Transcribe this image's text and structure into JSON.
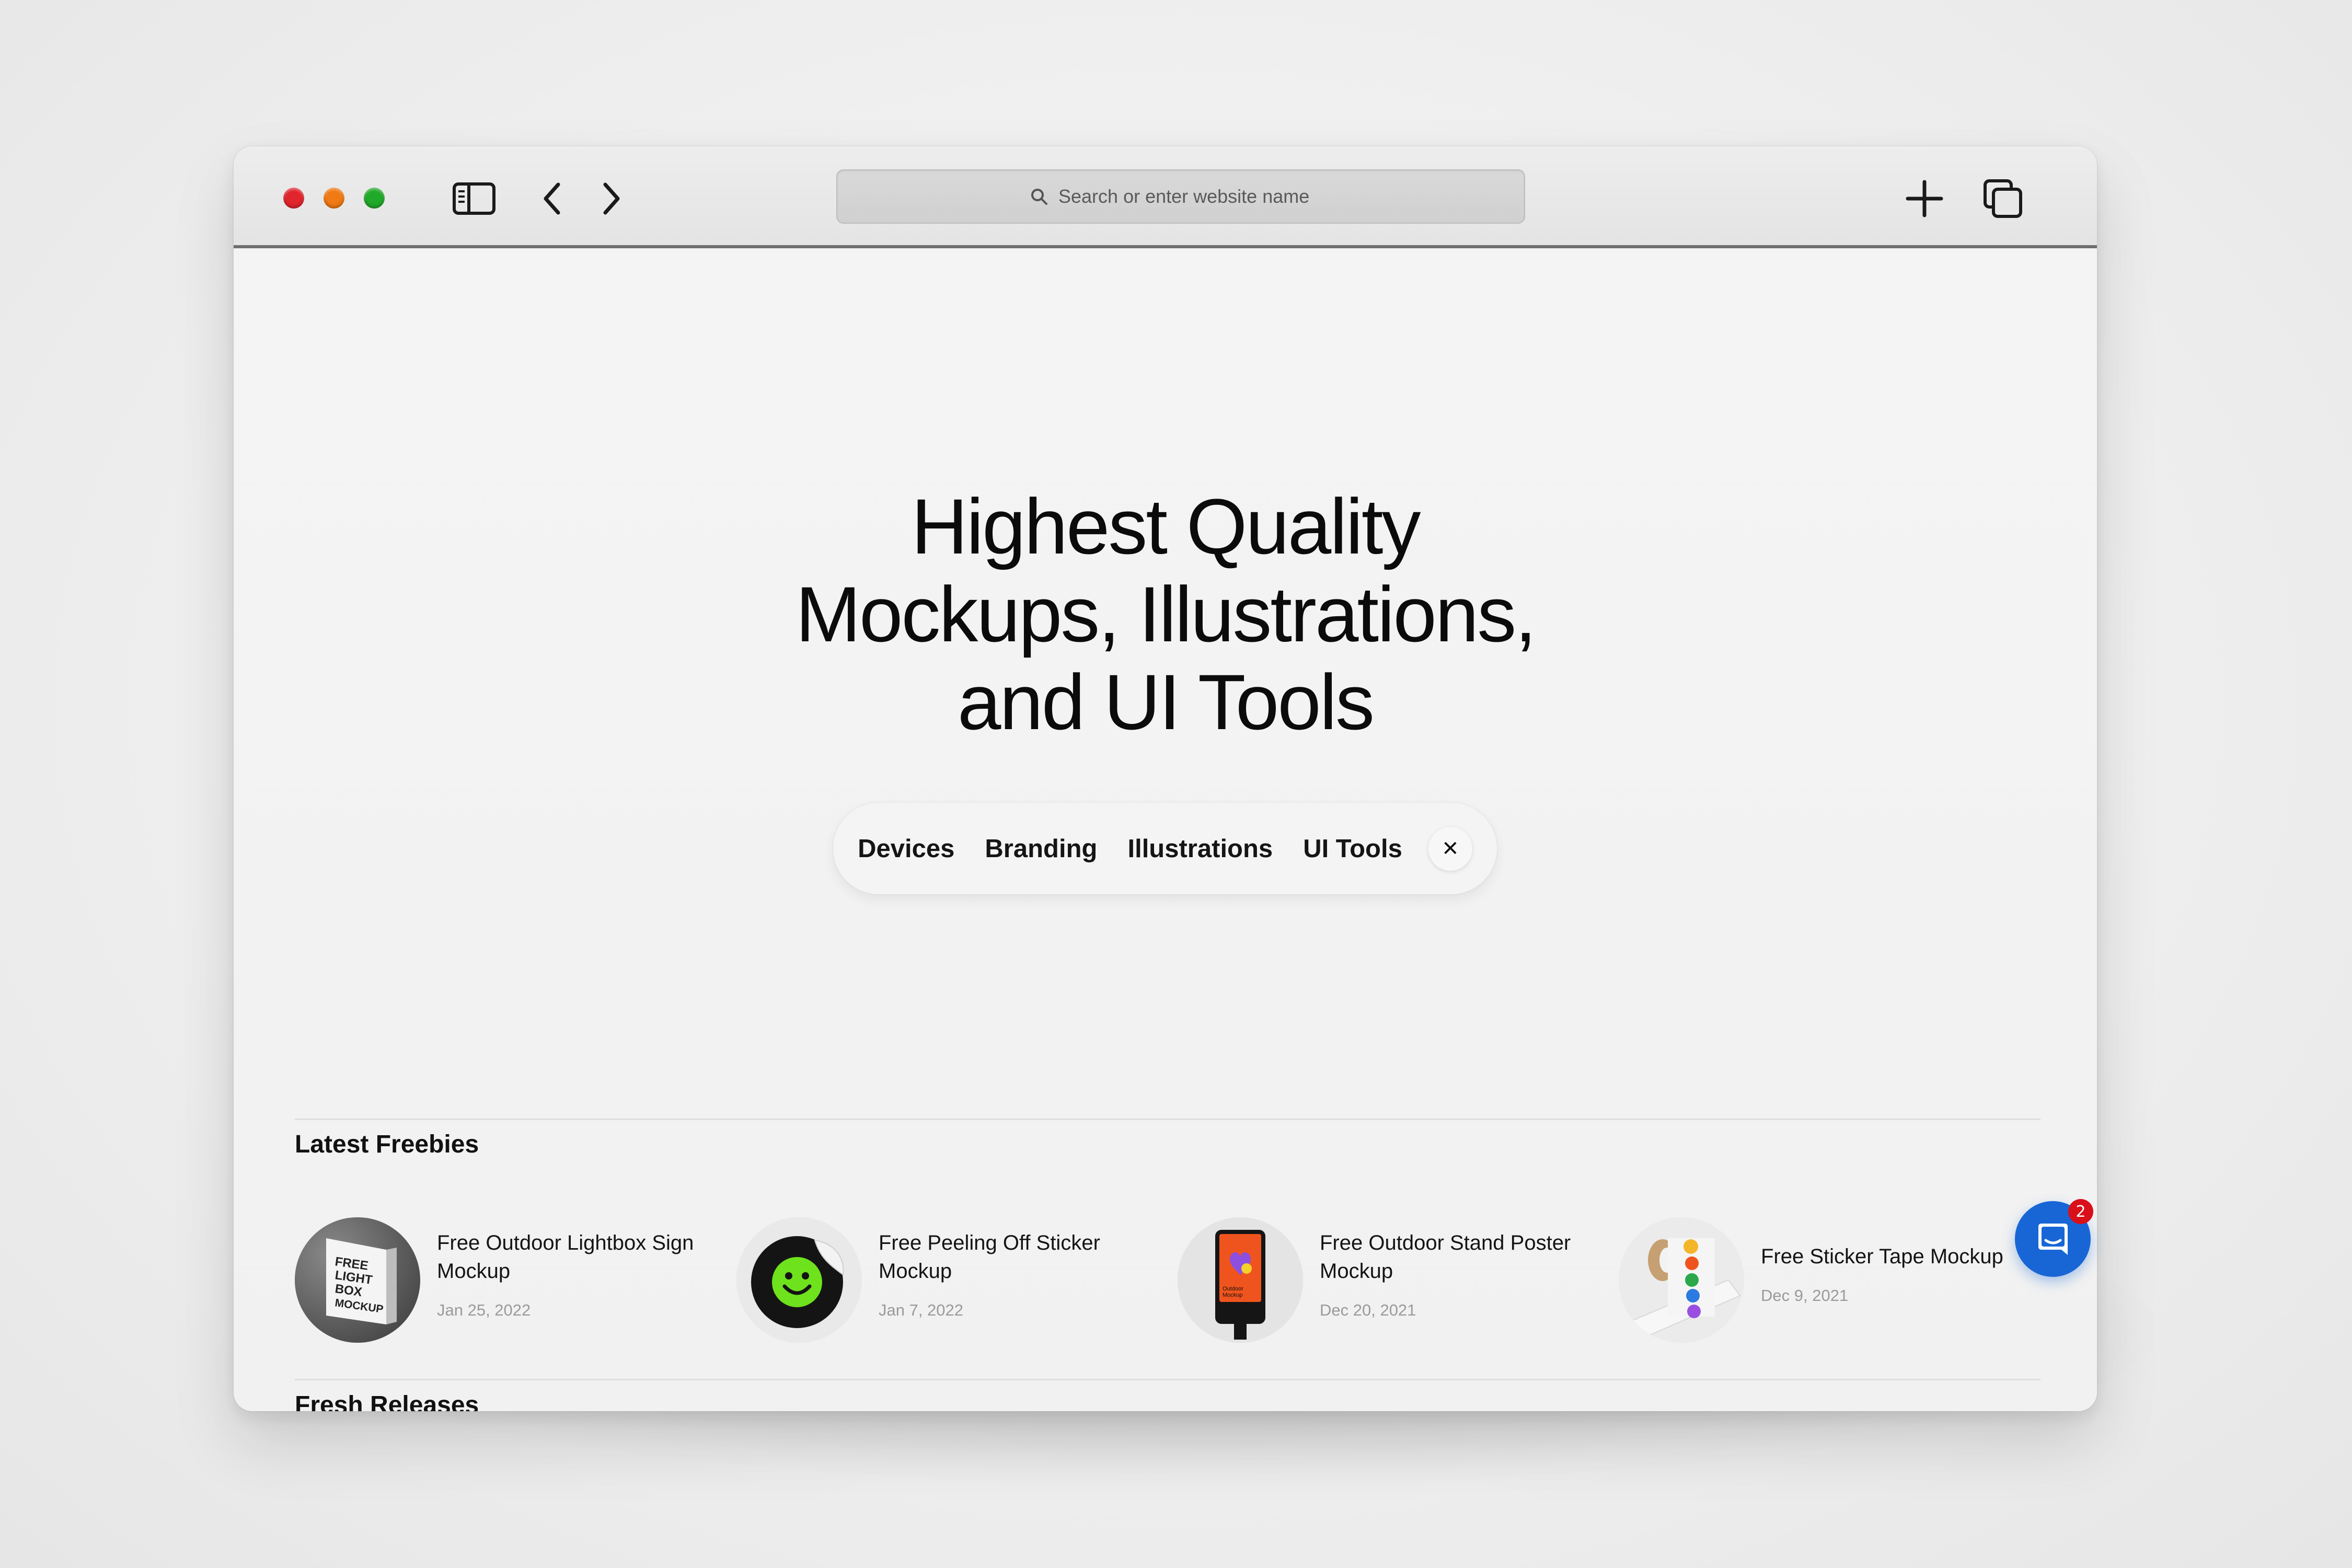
{
  "browser": {
    "address_placeholder": "Search or enter website name",
    "icons": {
      "sidebar": "sidebar-icon",
      "back": "chevron-left-icon",
      "forward": "chevron-right-icon",
      "search": "search-icon",
      "new_tab": "plus-icon",
      "tabs": "tabs-overview-icon"
    },
    "colors": {
      "traffic_red": "#e0252d",
      "traffic_yellow": "#f07a13",
      "traffic_green": "#21a929"
    }
  },
  "hero": {
    "lines": [
      "Highest Quality",
      "Mockups, Illustrations,",
      "and UI Tools"
    ]
  },
  "categories": [
    "Devices",
    "Branding",
    "Illustrations",
    "UI Tools"
  ],
  "categories_close_label": "✕",
  "latest_freebies": {
    "title": "Latest Freebies",
    "items": [
      {
        "title_lines": [
          "Free Outdoor Lightbox Sign",
          "Mockup"
        ],
        "date": "Jan 25, 2022",
        "thumb_text": [
          "FREE",
          "LIGHT",
          "BOX",
          "MOCKUP"
        ]
      },
      {
        "title_lines": [
          "Free Peeling Off Sticker",
          "Mockup"
        ],
        "date": "Jan 7, 2022"
      },
      {
        "title_lines": [
          "Free Outdoor Stand Poster",
          "Mockup"
        ],
        "date": "Dec 20, 2021",
        "thumb_text": [
          "Outdoor",
          "Mockup"
        ]
      },
      {
        "title_lines": [
          "Free Sticker Tape Mockup"
        ],
        "date": "Dec 9, 2021"
      }
    ]
  },
  "fresh_releases": {
    "title": "Fresh Releases"
  },
  "chat": {
    "badge_count": "2",
    "brand_color": "#1866d6"
  }
}
